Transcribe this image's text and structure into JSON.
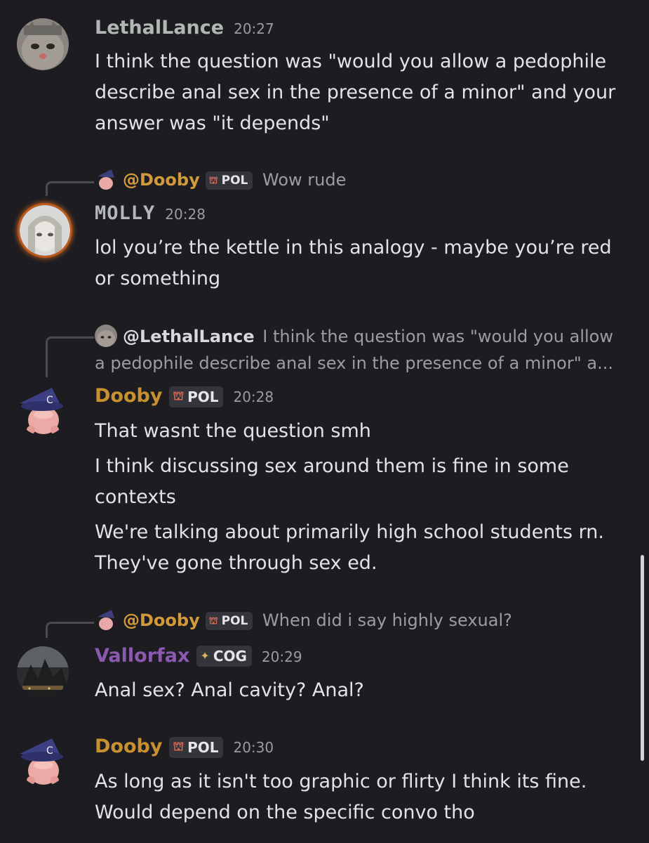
{
  "messages": [
    {
      "author": "LethalLance",
      "time": "20:27",
      "name_color": "#b0b7b4",
      "lines": [
        "I think the question was \"would you allow a pedophile describe anal sex in the presence of a minor\" and your answer was \"it depends\""
      ]
    },
    {
      "reply": {
        "author": "@Dooby",
        "badge": "POL",
        "text": "Wow rude"
      },
      "author": "MOLLY",
      "time": "20:28",
      "name_color": "#b5b7bf",
      "lines": [
        "lol you’re the kettle in this analogy - maybe you’re red or something"
      ]
    },
    {
      "reply": {
        "author": "@LethalLance",
        "text": "I think the question was \"would you allow",
        "text2": "a pedophile describe anal sex in the presence of a minor\" a..."
      },
      "author": "Dooby",
      "badge": "POL",
      "time": "20:28",
      "name_color": "#c8902f",
      "lines": [
        "That wasnt the question smh",
        "I think discussing sex around them is fine in some contexts",
        "We're talking about primarily high school students rn. They've gone through sex ed."
      ]
    },
    {
      "reply": {
        "author": "@Dooby",
        "badge": "POL",
        "text": "When did i say highly sexual?"
      },
      "author": "Vallorfax",
      "badge": "COG",
      "time": "20:29",
      "name_color": "#8b5ab0",
      "lines": [
        "Anal sex? Anal cavity? Anal?"
      ]
    },
    {
      "author": "Dooby",
      "badge": "POL",
      "time": "20:30",
      "name_color": "#c8902f",
      "lines": [
        "As long as it isn't too graphic or flirty I think its fine. Would depend on the specific convo tho"
      ]
    }
  ],
  "icons": {
    "pol_badge": "castle-badge-icon",
    "cog_badge": "diamond-badge-icon"
  }
}
